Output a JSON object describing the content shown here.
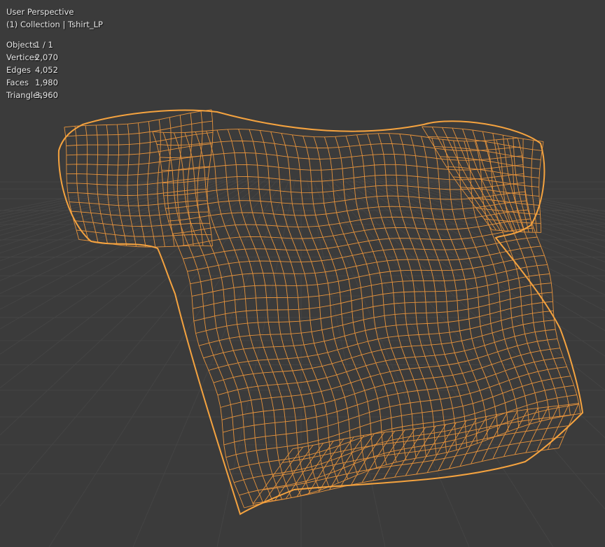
{
  "viewport": {
    "view_name": "User Perspective",
    "collection_line": "(1) Collection | Tshirt_LP",
    "stats": [
      {
        "label": "Objects",
        "value": "1 / 1"
      },
      {
        "label": "Vertices",
        "value": "2,070"
      },
      {
        "label": "Edges",
        "value": "4,052"
      },
      {
        "label": "Faces",
        "value": "1,980"
      },
      {
        "label": "Triangles",
        "value": "3,960"
      }
    ]
  },
  "colors": {
    "background": "#3b3b3b",
    "grid": "#444444",
    "wire": "#f0983c",
    "outline": "#f5a33f"
  }
}
